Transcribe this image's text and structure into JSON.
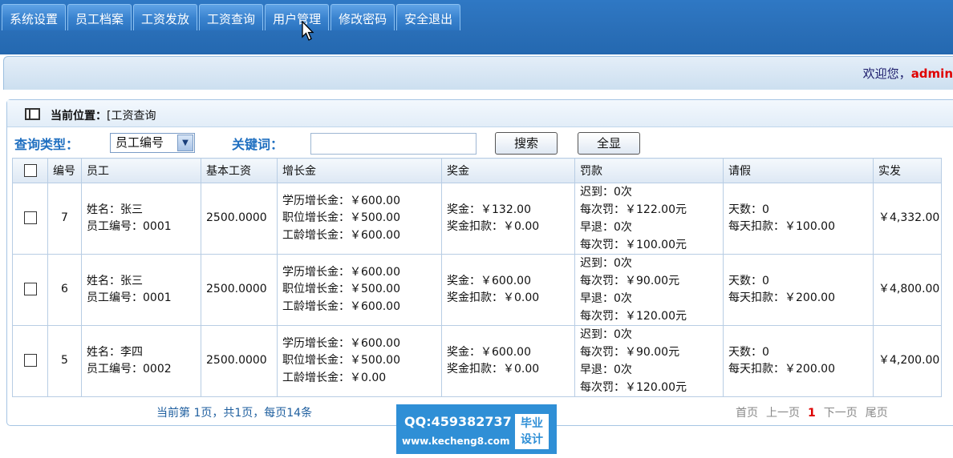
{
  "nav": {
    "tabs": [
      "系统设置",
      "员工档案",
      "工资发放",
      "工资查询",
      "用户管理",
      "修改密码",
      "安全退出"
    ]
  },
  "welcome": {
    "prefix": "欢迎您，",
    "user": "admin"
  },
  "location": {
    "label": "当前位置：",
    "value": "[工资查询"
  },
  "search": {
    "type_label": "查询类型：",
    "type_selected": "员工编号",
    "keyword_label": "关键词：",
    "keyword_value": "",
    "search_button": "搜索",
    "show_all_button": "全显"
  },
  "table": {
    "headers": [
      "编号",
      "员工",
      "基本工资",
      "增长金",
      "奖金",
      "罚款",
      "请假",
      "实发"
    ],
    "rows": [
      {
        "id": "7",
        "employee": [
          "姓名：张三",
          "员工编号：0001"
        ],
        "base": "2500.0000",
        "growth": [
          "学历增长金：￥600.00",
          "职位增长金：￥500.00",
          "工龄增长金：￥600.00"
        ],
        "bonus": [
          "奖金：￥132.00",
          "奖金扣款：￥0.00"
        ],
        "fine": [
          "迟到：0次",
          "每次罚：￥122.00元",
          "早退：0次",
          "每次罚：￥100.00元"
        ],
        "leave": [
          "天数：0",
          "每天扣款：￥100.00"
        ],
        "pay": "￥4,332.00"
      },
      {
        "id": "6",
        "employee": [
          "姓名：张三",
          "员工编号：0001"
        ],
        "base": "2500.0000",
        "growth": [
          "学历增长金：￥600.00",
          "职位增长金：￥500.00",
          "工龄增长金：￥600.00"
        ],
        "bonus": [
          "奖金：￥600.00",
          "奖金扣款：￥0.00"
        ],
        "fine": [
          "迟到：0次",
          "每次罚：￥90.00元",
          "早退：0次",
          "每次罚：￥120.00元"
        ],
        "leave": [
          "天数：0",
          "每天扣款：￥200.00"
        ],
        "pay": "￥4,800.00"
      },
      {
        "id": "5",
        "employee": [
          "姓名：李四",
          "员工编号：0002"
        ],
        "base": "2500.0000",
        "growth": [
          "学历增长金：￥600.00",
          "职位增长金：￥500.00",
          "工龄增长金：￥0.00"
        ],
        "bonus": [
          "奖金：￥600.00",
          "奖金扣款：￥0.00"
        ],
        "fine": [
          "迟到：0次",
          "每次罚：￥90.00元",
          "早退：0次",
          "每次罚：￥120.00元"
        ],
        "leave": [
          "天数：0",
          "每天扣款：￥200.00"
        ],
        "pay": "￥4,200.00"
      }
    ]
  },
  "pagination": {
    "summary": "当前第 1页，共1页，每页14条",
    "first": "首页",
    "prev": "上一页",
    "current": "1",
    "next": "下一页",
    "last": "尾页"
  },
  "watermark": {
    "qq": "QQ:459382737",
    "url": "www.kecheng8.com",
    "badge_line1": "毕业",
    "badge_line2": "设计"
  }
}
